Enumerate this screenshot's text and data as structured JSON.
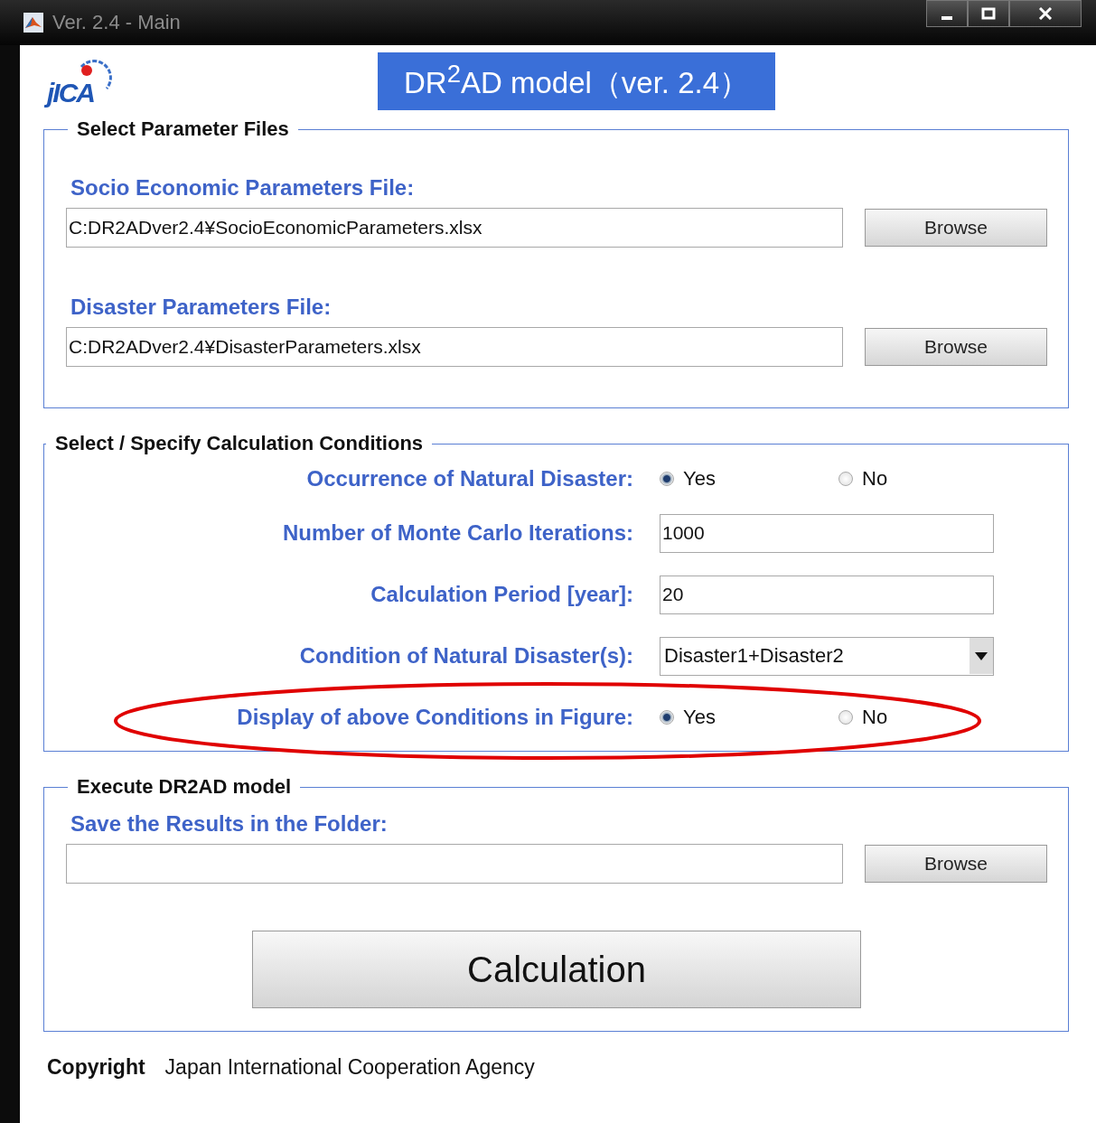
{
  "window": {
    "title": "Ver. 2.4 - Main"
  },
  "logo": {
    "text": "jICA"
  },
  "banner": {
    "title": "DR$^{2}$AD model（ver. 2.4）"
  },
  "parameter_files": {
    "title": "Select Parameter Files",
    "files": [
      {
        "label": "Socio Economic Parameters File:",
        "value": "C:DR2ADver2.4¥SocioEconomicParameters.xlsx",
        "button": "Browse"
      },
      {
        "label": "Disaster Parameters File:",
        "value": "C:DR2ADver2.4¥DisasterParameters.xlsx",
        "button": "Browse"
      }
    ]
  },
  "conditions": {
    "title": "Select / Specify Calculation Conditions",
    "rows": [
      {
        "kind": "radio",
        "label": "Occurrence of Natural Disaster:",
        "circled": false,
        "options": [
          {
            "label": "Yes",
            "selected": true
          },
          {
            "label": "No",
            "selected": false
          }
        ]
      },
      {
        "kind": "text",
        "label": "Number of Monte Carlo Iterations:",
        "value": "1000"
      },
      {
        "kind": "text",
        "label": "Calculation Period [year]:",
        "value": "20"
      },
      {
        "kind": "select",
        "label": "Condition of Natural Disaster(s):",
        "value": "Disaster1+Disaster2"
      },
      {
        "kind": "radio",
        "label": "Display of above Conditions in Figure:",
        "circled": true,
        "options": [
          {
            "label": "Yes",
            "selected": true
          },
          {
            "label": "No",
            "selected": false
          }
        ]
      }
    ]
  },
  "execute": {
    "title": "Execute DR2AD model",
    "folder_label": "Save the Results in the Folder:",
    "browse_button": "Browse",
    "calculate_button": "Calculation"
  },
  "footer": {
    "label": "Copyright",
    "text": "Japan International Cooperation Agency"
  }
}
